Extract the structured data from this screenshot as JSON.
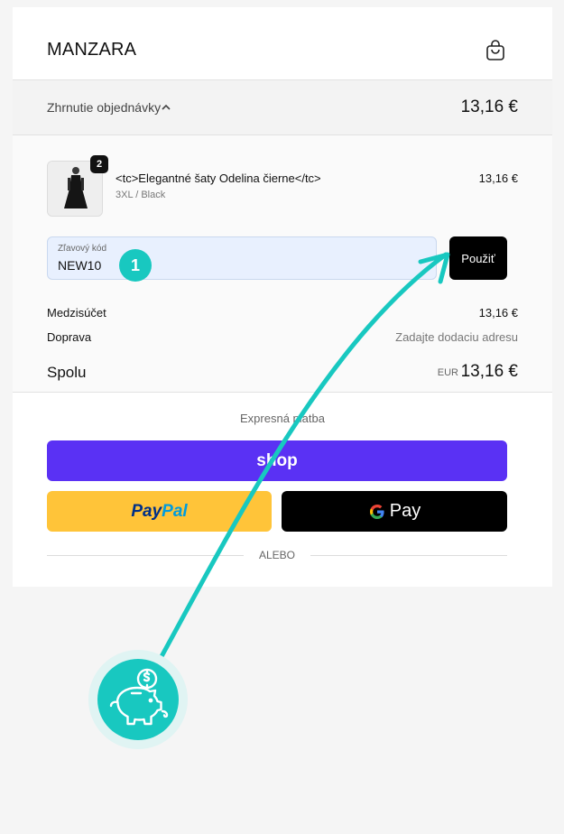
{
  "header": {
    "brand": "MANZARA",
    "cart_icon": "shopping-bag-icon"
  },
  "summary": {
    "label": "Zhrnutie objednávky",
    "total": "13,16 €"
  },
  "product": {
    "quantity": "2",
    "name": "<tc>Elegantné šaty Odelina čierne</tc>",
    "variant": "3XL / Black",
    "price": "13,16 €"
  },
  "discount": {
    "label": "Zľavový kód",
    "value": "NEW10",
    "apply_label": "Použiť"
  },
  "tutorial": {
    "step_number": "1"
  },
  "totals": {
    "subtotal_label": "Medzisúčet",
    "subtotal_value": "13,16 €",
    "shipping_label": "Doprava",
    "shipping_value": "Zadajte dodaciu adresu",
    "total_label": "Spolu",
    "total_currency": "EUR",
    "total_value": "13,16 €"
  },
  "express": {
    "label": "Expresná platba",
    "shop_label": "shop",
    "paypal_label_a": "Pay",
    "paypal_label_b": "Pal",
    "gpay_label": "Pay",
    "or_label": "ALEBO"
  },
  "colors": {
    "accent_teal": "#18c8c0",
    "shop_purple": "#5a31f4",
    "paypal_yellow": "#ffc439",
    "button_black": "#000000"
  }
}
